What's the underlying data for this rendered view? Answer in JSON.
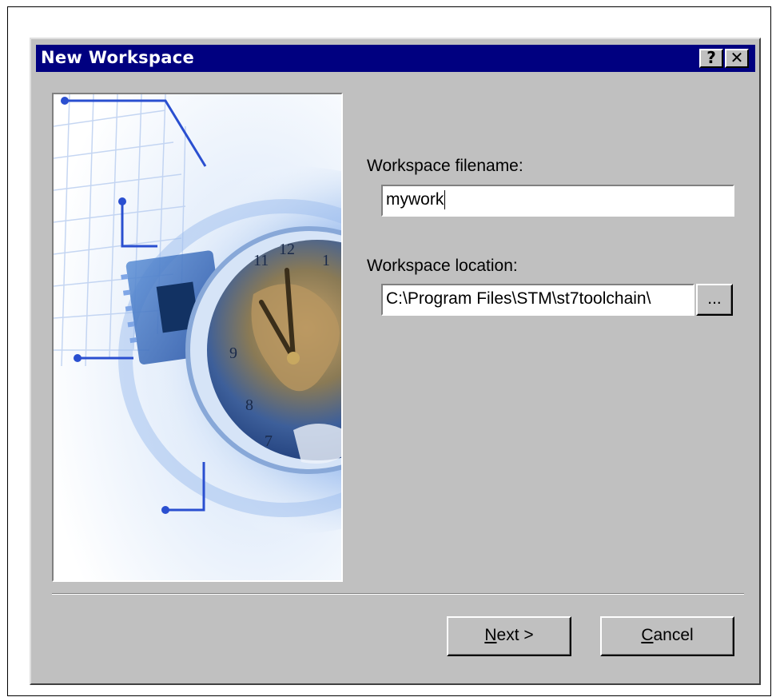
{
  "window": {
    "title": "New Workspace",
    "help_glyph": "?",
    "close_glyph": "✕",
    "help_icon": "question-icon",
    "close_icon": "close-icon"
  },
  "image": {
    "description_icon": "wizard-illustration-icon"
  },
  "form": {
    "filename_label": "Workspace filename:",
    "filename_value": "mywork",
    "location_label": "Workspace location:",
    "location_value": "C:\\Program Files\\STM\\st7toolchain\\",
    "browse_label": "..."
  },
  "buttons": {
    "next_mnemonic": "N",
    "next_rest": "ext >",
    "cancel_mnemonic": "C",
    "cancel_rest": "ancel"
  },
  "colors": {
    "titlebar": "#000080",
    "dialog_bg": "#c0c0c0",
    "accent_blue": "#2a4fd0"
  }
}
